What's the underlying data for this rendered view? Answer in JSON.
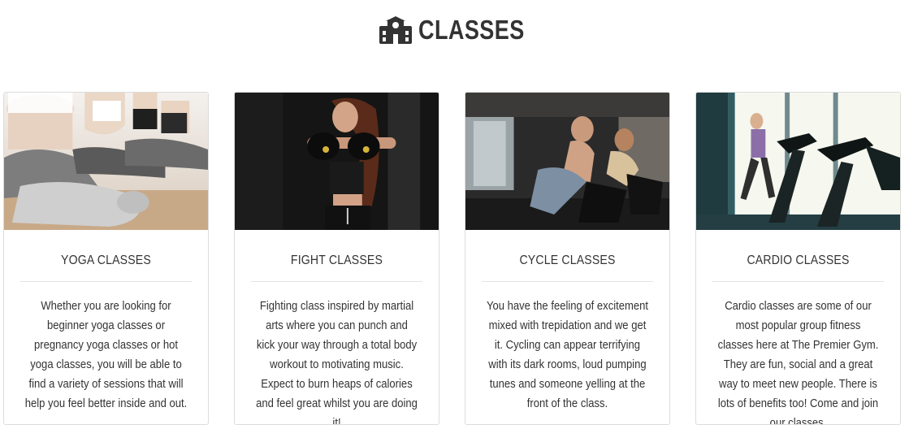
{
  "header": {
    "title": "CLASSES",
    "icon": "school-building-icon"
  },
  "cards": [
    {
      "title": "YOGA CLASSES",
      "text": "Whether you are looking for beginner yoga classes or pregnancy yoga classes or hot yoga classes, you will be able to find a variety of sessions that will help you feel better inside and out."
    },
    {
      "title": "FIGHT CLASSES",
      "text": "Fighting class inspired by martial arts where you can punch and kick your way through a total body workout to motivating music. Expect to burn heaps of calories and feel great whilst you are doing it!"
    },
    {
      "title": "CYCLE CLASSES",
      "text": "You have the feeling of excitement mixed with trepidation and we get it. Cycling can appear terrifying with its dark rooms, loud pumping tunes and someone yelling at the front of the class."
    },
    {
      "title": "CARDIO CLASSES",
      "text": "Cardio classes are some of our most popular group fitness classes here at The Premier Gym. They are fun, social and a great way to meet new people. There is lots of benefits too! Come and join our classes."
    }
  ]
}
